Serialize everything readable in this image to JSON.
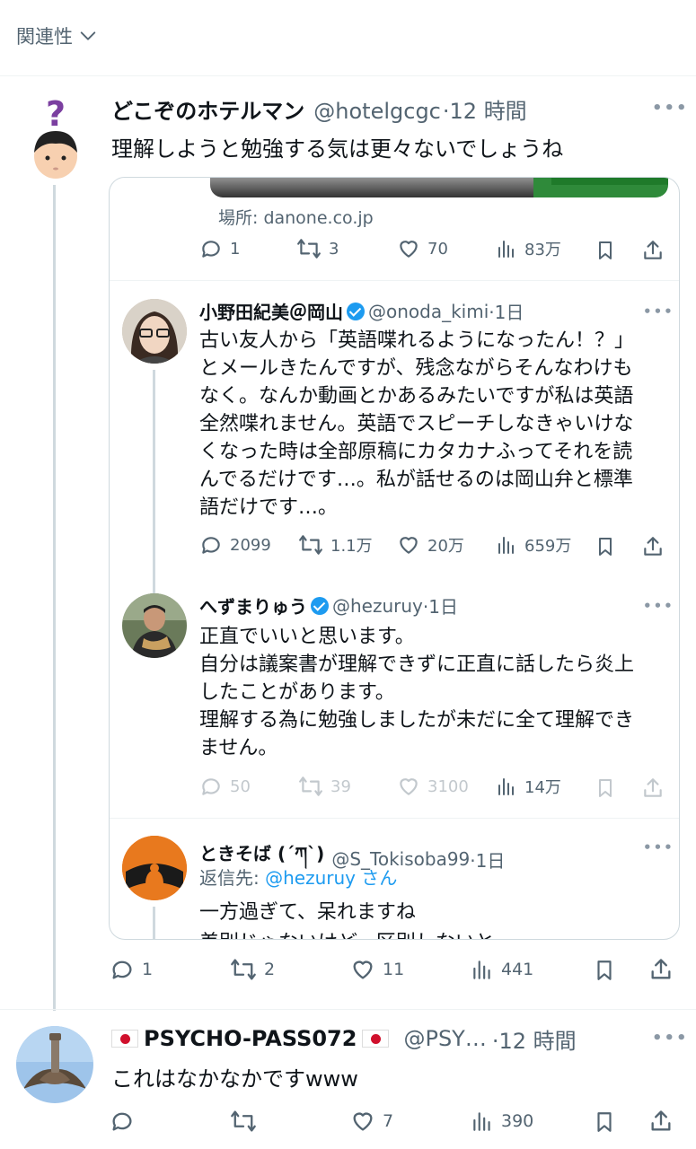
{
  "filter": {
    "label": "関連性"
  },
  "tweet1": {
    "display_name": "どこぞのホテルマン",
    "handle": "@hotelgcgc",
    "time": "·12 時間",
    "text": "理解しようと勉強する気は更々ないでしょうね",
    "stats": {
      "replies": "1",
      "retweets": "2",
      "likes": "11",
      "views": "441"
    }
  },
  "quote": {
    "place": "場所: danone.co.jp",
    "top_stats": {
      "replies": "1",
      "retweets": "3",
      "likes": "70",
      "views": "83万"
    },
    "posts": [
      {
        "display_name": "小野田紀美＠岡山",
        "handle": "@onoda_kimi",
        "time": "·1日",
        "lines": [
          "古い友人から「英語喋れるようになったん！？」",
          "とメールきたんですが、残念ながらそんなわけも",
          "なく。なんか動画とかあるみたいですが私は英語",
          "全然喋れません。英語でスピーチしなきゃいけな",
          "くなった時は全部原稿にカタカナふってそれを読",
          "んでるだけです…。私が話せるのは岡山弁と標準",
          "語だけです…。"
        ],
        "stats": {
          "replies": "2099",
          "retweets": "1.1万",
          "likes": "20万",
          "views": "659万"
        }
      },
      {
        "display_name": "へずまりゅう",
        "handle": "@hezuruy",
        "time": "·1日",
        "lines": [
          "正直でいいと思います。",
          "自分は議案書が理解できずに正直に話したら炎上",
          "したことがあります。",
          "理解する為に勉強しましたが未だに全て理解でき",
          "ません。"
        ],
        "stats": {
          "replies": "50",
          "retweets": "39",
          "likes": "3100",
          "views": "14万"
        }
      },
      {
        "display_name": "ときそば (´ཀ`)",
        "handle": "@S_Tokisoba99",
        "time": "·1日",
        "reply_prefix": "返信先: ",
        "reply_to": "@hezuruy",
        "reply_suffix": " さん",
        "lines": [
          "一方過ぎて、呆れますね",
          "差別じゃないけど、区別しないと"
        ]
      }
    ]
  },
  "tweet2": {
    "display_name": "PSYCHO-PASS072",
    "handle": "@PSY…",
    "time": "·12 時間",
    "text": "これはなかなかですwww",
    "stats": {
      "replies": "",
      "retweets": "",
      "likes": "7",
      "views": "390"
    }
  },
  "colors": {
    "accent": "#1d9bf0",
    "muted": "#536471",
    "border": "#cfd9de"
  }
}
